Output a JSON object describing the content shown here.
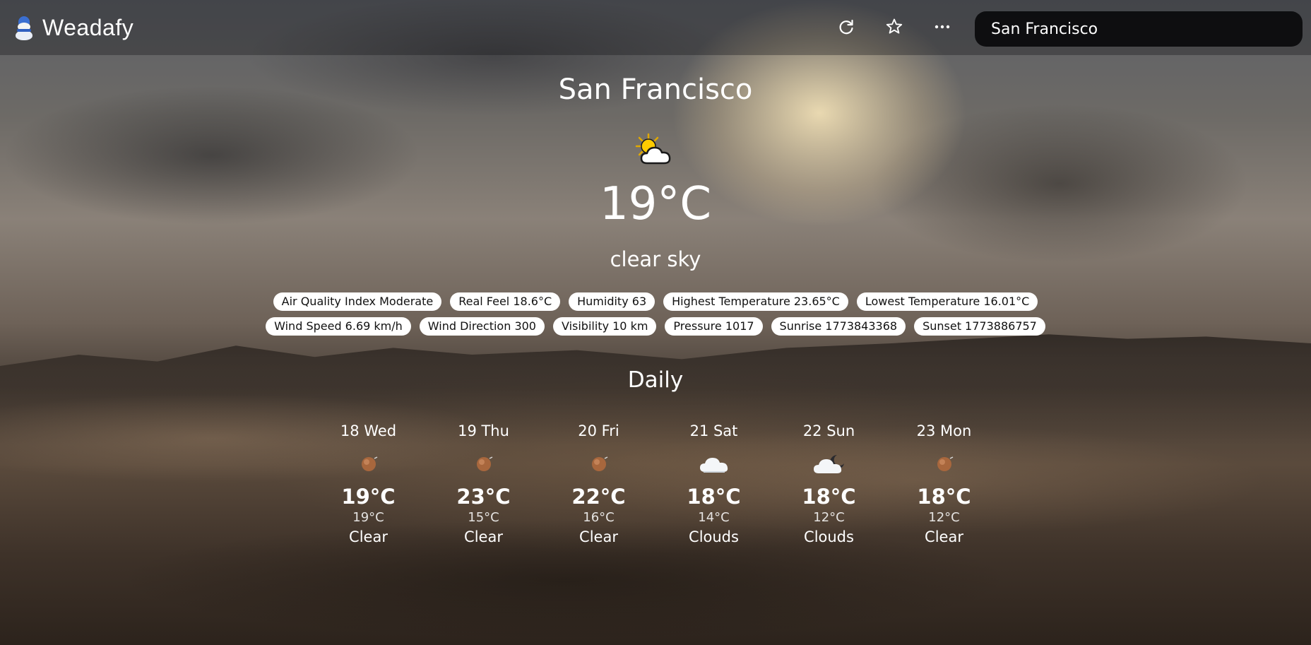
{
  "app": {
    "name": "Weadafy",
    "logo_icon": "snowman-logo-icon"
  },
  "toolbar": {
    "refresh_icon": "refresh-icon",
    "favorite_icon": "star-icon",
    "more_icon": "more-dots-icon",
    "refresh_glyph": "⟳",
    "favorite_glyph": "☆",
    "more_glyph": "···"
  },
  "search": {
    "value": "San Francisco",
    "placeholder": ""
  },
  "current": {
    "city": "San Francisco",
    "icon": "sun-behind-cloud-icon",
    "temperature": "19°C",
    "description": "clear sky"
  },
  "details_row1": [
    "Air Quality Index Moderate",
    "Real Feel 18.6°C",
    "Humidity 63",
    "Highest Temperature 23.65°C",
    "Lowest Temperature 16.01°C"
  ],
  "details_row2": [
    "Wind Speed 6.69 km/h",
    "Wind Direction 300",
    "Visibility 10 km",
    "Pressure 1017",
    "Sunrise 1773843368",
    "Sunset 1773886757"
  ],
  "daily": {
    "title": "Daily",
    "days": [
      {
        "name": "18 Wed",
        "icon": "clear-sun-icon",
        "max": "19°C",
        "min": "19°C",
        "desc": "Clear"
      },
      {
        "name": "19 Thu",
        "icon": "clear-sun-icon",
        "max": "23°C",
        "min": "15°C",
        "desc": "Clear"
      },
      {
        "name": "20 Fri",
        "icon": "clear-sun-icon",
        "max": "22°C",
        "min": "16°C",
        "desc": "Clear"
      },
      {
        "name": "21 Sat",
        "icon": "cloud-icon",
        "max": "18°C",
        "min": "14°C",
        "desc": "Clouds"
      },
      {
        "name": "22 Sun",
        "icon": "cloud-moon-icon",
        "max": "18°C",
        "min": "12°C",
        "desc": "Clouds"
      },
      {
        "name": "23 Mon",
        "icon": "clear-sun-icon",
        "max": "18°C",
        "min": "12°C",
        "desc": "Clear"
      }
    ]
  },
  "colors": {
    "chip_bg": "#ffffff",
    "chip_text": "#111111",
    "search_bg": "#08080a"
  }
}
